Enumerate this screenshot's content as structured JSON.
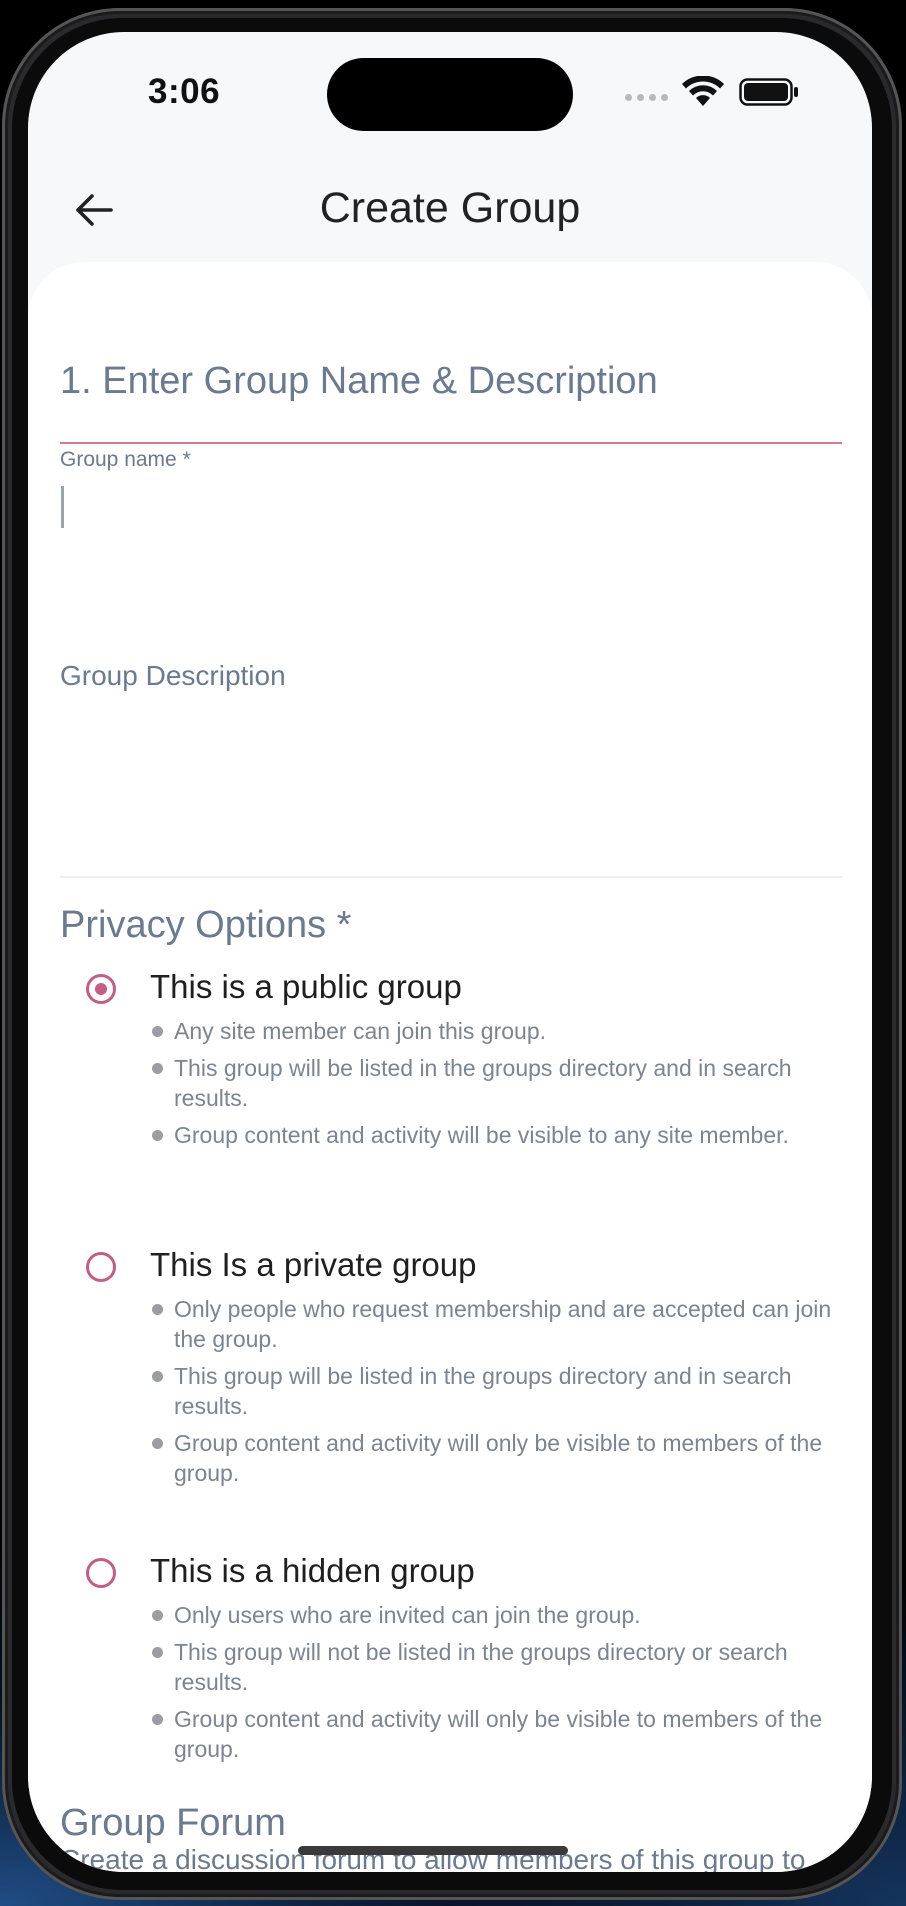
{
  "status_bar": {
    "time": "3:06"
  },
  "header": {
    "title": "Create Group",
    "back_icon": "arrow-left-icon"
  },
  "section_name": {
    "title": "1. Enter Group Name & Description",
    "group_name_label": "Group name *",
    "group_name_value": "",
    "group_description_label": "Group Description",
    "group_description_value": ""
  },
  "privacy": {
    "title": "Privacy Options *",
    "selected": "public",
    "options": [
      {
        "key": "public",
        "label": "This is a public group",
        "bullets": [
          "Any site member can join this group.",
          "This group will be listed in the groups directory and in search results.",
          "Group content and activity will be visible to any site member."
        ]
      },
      {
        "key": "private",
        "label": "This Is a private group",
        "bullets": [
          "Only people who request membership and are accepted can join the group.",
          "This group will be listed in the groups directory and in search results.",
          "Group content and activity will only be visible to members of the group."
        ]
      },
      {
        "key": "hidden",
        "label": "This is a hidden group",
        "bullets": [
          "Only users who are invited can join the group.",
          "This group will not be listed in the groups directory or search results.",
          "Group content and activity will only be visible to members of the group."
        ]
      }
    ]
  },
  "forum": {
    "title": "Group Forum",
    "description": "Create a discussion forum to allow members of this group to"
  },
  "colors": {
    "accent": "#c45e86",
    "muted_text": "#6b7a90"
  }
}
